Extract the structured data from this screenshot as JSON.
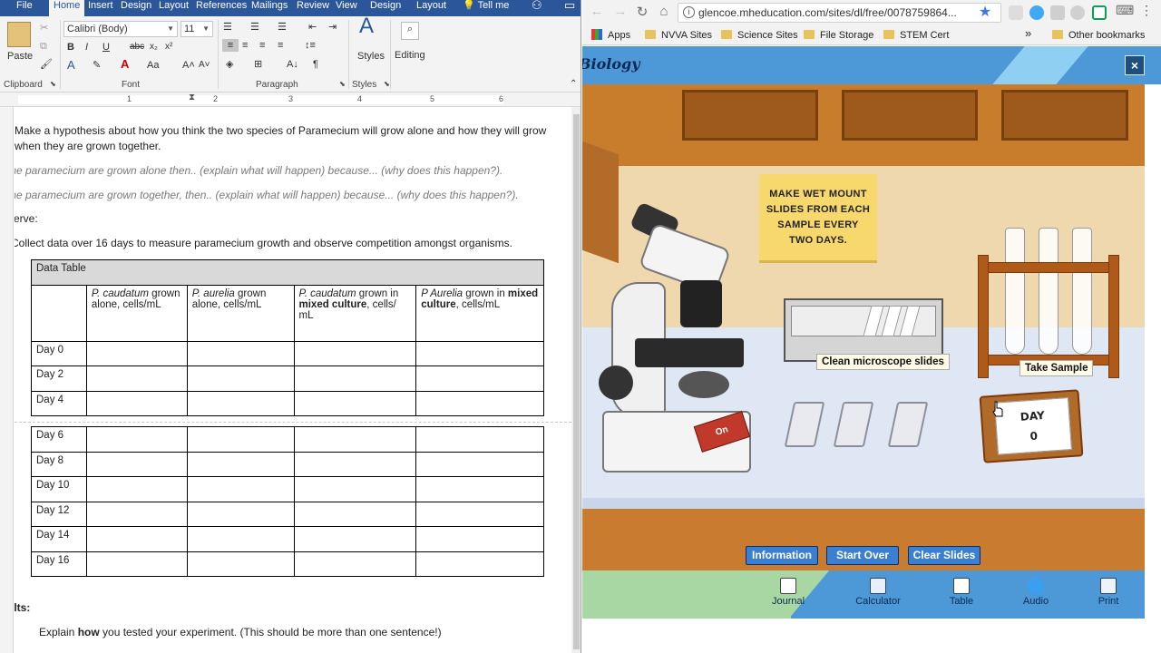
{
  "word": {
    "tabs": [
      "File",
      "Home",
      "Insert",
      "Design",
      "Layout",
      "References",
      "Mailings",
      "Review",
      "View",
      "Design",
      "Layout",
      "Tell me"
    ],
    "ribbon": {
      "paste": "Paste",
      "font_name": "Calibri (Body)",
      "font_size": "11",
      "styles": "Styles",
      "editing": "Editing",
      "groups": [
        "Clipboard",
        "Font",
        "Paragraph",
        "Styles"
      ]
    },
    "ruler_numbers": [
      "1",
      "2",
      "3",
      "4",
      "5",
      "6"
    ],
    "doc": {
      "line1": "Make a hypothesis about how you think the two species of Paramecium will grow alone and how they will grow",
      "line2": "when they are grown together.",
      "hint1": "The paramecium are grown alone then.. (explain what will happen) because...  (why does this happen?).",
      "hint2": "The paramecium are grown together, then.. (explain what will happen) because...  (why does this happen?).",
      "observe": "Observe:",
      "collect": "Collect data over 16 days to measure paramecium growth and observe competition amongst organisms.",
      "table_title": "Data Table",
      "columns": [
        {
          "italic": "P. caudatum",
          "rest": " grown alone, cells/mL",
          "bold": ""
        },
        {
          "italic": "P. aurelia",
          "rest": " grown alone, cells/mL",
          "bold": ""
        },
        {
          "italic": "P. caudatum",
          "rest": " grown in ",
          "bold": "mixed culture",
          "tail": ", cells/ mL"
        },
        {
          "italic": "P Aurelia",
          "rest": " grown in ",
          "bold": "mixed culture",
          "tail": ", cells/mL"
        }
      ],
      "days_top": [
        "Day 0",
        "Day 2",
        "Day 4"
      ],
      "days_bottom": [
        "Day 6",
        "Day 8",
        "Day 10",
        "Day 12",
        "Day 14",
        "Day 16"
      ],
      "results": "Results:",
      "explain_pre": "Explain ",
      "explain_bold": "how",
      "explain_post": " you tested your experiment.  (This should be more than one sentence!)"
    }
  },
  "browser": {
    "url": "glencoe.mheducation.com/sites/dl/free/0078759864...",
    "bookmarks": [
      "Apps",
      "NVVA Sites",
      "Science Sites",
      "File Storage",
      "STEM Cert",
      "Other bookmarks"
    ],
    "more": "»"
  },
  "sim": {
    "title": "Biology",
    "close": "×",
    "note": [
      "MAKE WET MOUNT",
      "SLIDES FROM EACH",
      "SAMPLE EVERY",
      "TWO DAYS."
    ],
    "clean_slides": "Clean microscope slides",
    "take_sample": "Take Sample",
    "day_label": "DAY",
    "day_value": "0",
    "scope_switch": "On",
    "buttons": [
      "Information",
      "Start Over",
      "Clear Slides"
    ],
    "tools": [
      "Journal",
      "Calculator",
      "Table",
      "Audio",
      "Print"
    ]
  },
  "colors": {
    "word_blue": "#2b579a",
    "sim_blue": "#4d98d6",
    "button_blue": "#3a7fd0"
  }
}
